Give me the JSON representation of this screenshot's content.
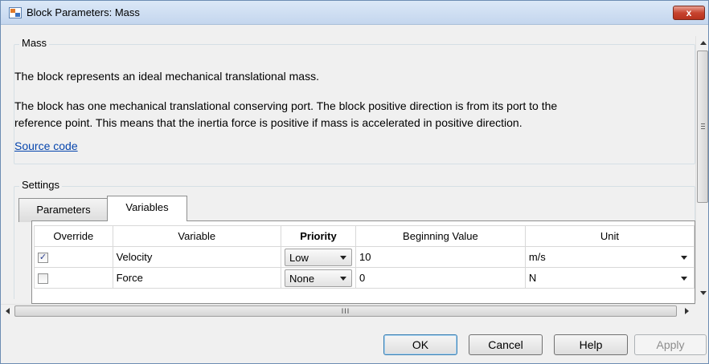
{
  "window": {
    "title": "Block Parameters: Mass",
    "close_label": "x"
  },
  "mass_group": {
    "legend": "Mass",
    "description_1": "The block represents an ideal mechanical translational mass.",
    "description_2_line1": "The block has one mechanical translational conserving port. The block positive direction is from its port to the",
    "description_2_line2": "reference point. This means that the inertia force is positive if mass is accelerated in positive direction.",
    "source_link": "Source code"
  },
  "settings_group": {
    "legend": "Settings",
    "tabs": [
      {
        "label": "Parameters",
        "active": false
      },
      {
        "label": "Variables",
        "active": true
      }
    ]
  },
  "variables_table": {
    "headers": {
      "override": "Override",
      "variable": "Variable",
      "priority": "Priority",
      "beginning_value": "Beginning Value",
      "unit": "Unit"
    },
    "rows": [
      {
        "override": true,
        "variable": "Velocity",
        "priority": "Low",
        "beginning_value": "10",
        "unit": "m/s"
      },
      {
        "override": false,
        "variable": "Force",
        "priority": "None",
        "beginning_value": "0",
        "unit": "N"
      }
    ]
  },
  "scrollbar": {
    "horizontal_grip": "III"
  },
  "buttons": {
    "ok": "OK",
    "cancel": "Cancel",
    "help": "Help",
    "apply": "Apply"
  }
}
